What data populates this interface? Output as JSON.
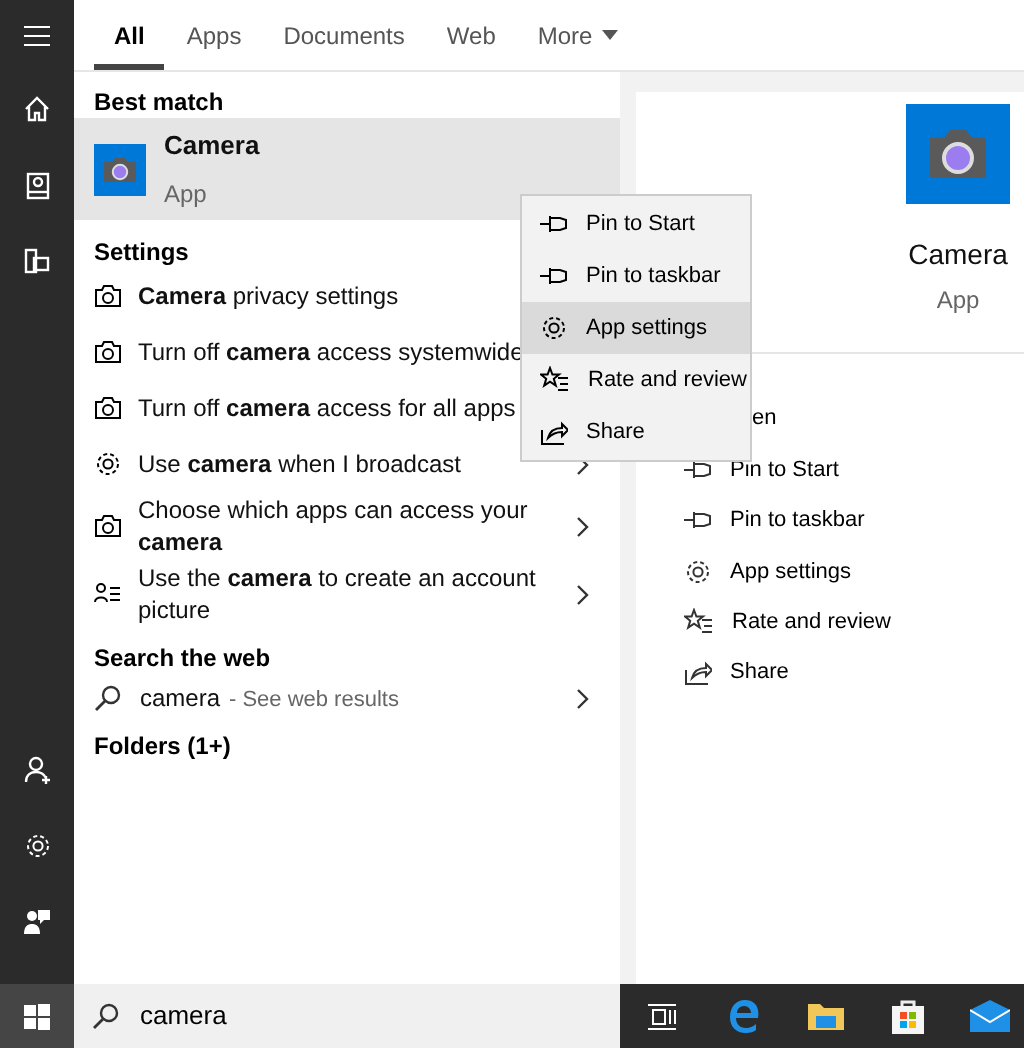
{
  "tabs": [
    {
      "label": "All",
      "selected": true
    },
    {
      "label": "Apps",
      "selected": false
    },
    {
      "label": "Documents",
      "selected": false
    },
    {
      "label": "Web",
      "selected": false
    },
    {
      "label": "More",
      "selected": false
    }
  ],
  "best_match": {
    "heading": "Best match",
    "name": "Camera",
    "type": "App",
    "selected": true
  },
  "settings": {
    "heading": "Settings",
    "items": [
      {
        "text": "**Camera** privacy settings"
      },
      {
        "text": "Turn off **camera** access systemwide"
      },
      {
        "text": "Turn off **camera** access for all apps"
      },
      {
        "text": "Use **camera** when I broadcast",
        "chevron": true
      },
      {
        "text": "Choose which apps can access your **camera**",
        "chevron": true
      },
      {
        "text": "Use the **camera** to create an account picture",
        "chevron": true
      }
    ]
  },
  "web": {
    "heading": "Search the web",
    "query": "camera",
    "hint": "- See web results"
  },
  "folders": {
    "heading": "Folders (1+)"
  },
  "context_menu": [
    {
      "label": "Pin to Start",
      "selected": false
    },
    {
      "label": "Pin to taskbar",
      "selected": false
    },
    {
      "label": "App settings",
      "selected": true
    },
    {
      "label": "Rate and review",
      "selected": false
    },
    {
      "label": "Share",
      "selected": false
    }
  ],
  "preview": {
    "name": "Camera",
    "type": "App",
    "actions": [
      {
        "kind": "partial",
        "label": "en"
      },
      {
        "kind": "full",
        "label": "Pin to Start"
      },
      {
        "kind": "full",
        "label": "Pin to taskbar"
      },
      {
        "kind": "full",
        "label": "App settings"
      },
      {
        "kind": "full",
        "label": "Rate and review"
      },
      {
        "kind": "full",
        "label": "Share"
      }
    ]
  },
  "search_box": {
    "value": "camera"
  }
}
